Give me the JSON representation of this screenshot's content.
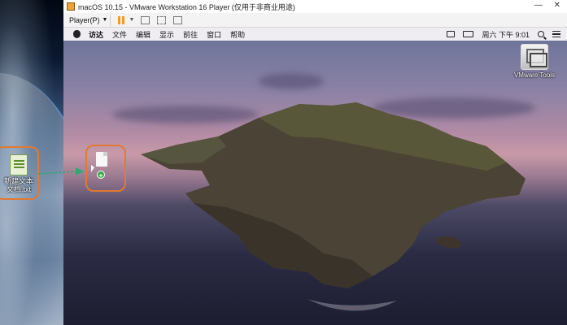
{
  "host": {
    "file_label": "新建文本文档.txt"
  },
  "vmware": {
    "window_title": "macOS 10.15 - VMware Workstation 16 Player (仅用于非商业用途)",
    "player_menu_label": "Player(P)",
    "window_controls": [
      "minimize-icon",
      "maximize-icon",
      "close-icon"
    ],
    "toolbar_icons": [
      "pause-icon",
      "send-ctrl-alt-del-icon",
      "fit-window-icon",
      "unity-icon"
    ]
  },
  "mac": {
    "menu_items": [
      "访达",
      "文件",
      "编辑",
      "显示",
      "前往",
      "窗口",
      "帮助"
    ],
    "clock": "周六 下午 9:01",
    "status_icons": [
      "keyboard-icon",
      "display-icon",
      "search-icon",
      "list-icon"
    ],
    "desktop_items": [
      {
        "label": "VMware Tools",
        "icon": "vmware-tools-icon"
      }
    ]
  },
  "drag": {
    "badge": "+"
  },
  "colors": {
    "highlight_ring": "#e07a34",
    "drag_arrow": "#2eaa6e",
    "pause_icon": "#f29b22",
    "add_badge": "#2eaa3c"
  }
}
